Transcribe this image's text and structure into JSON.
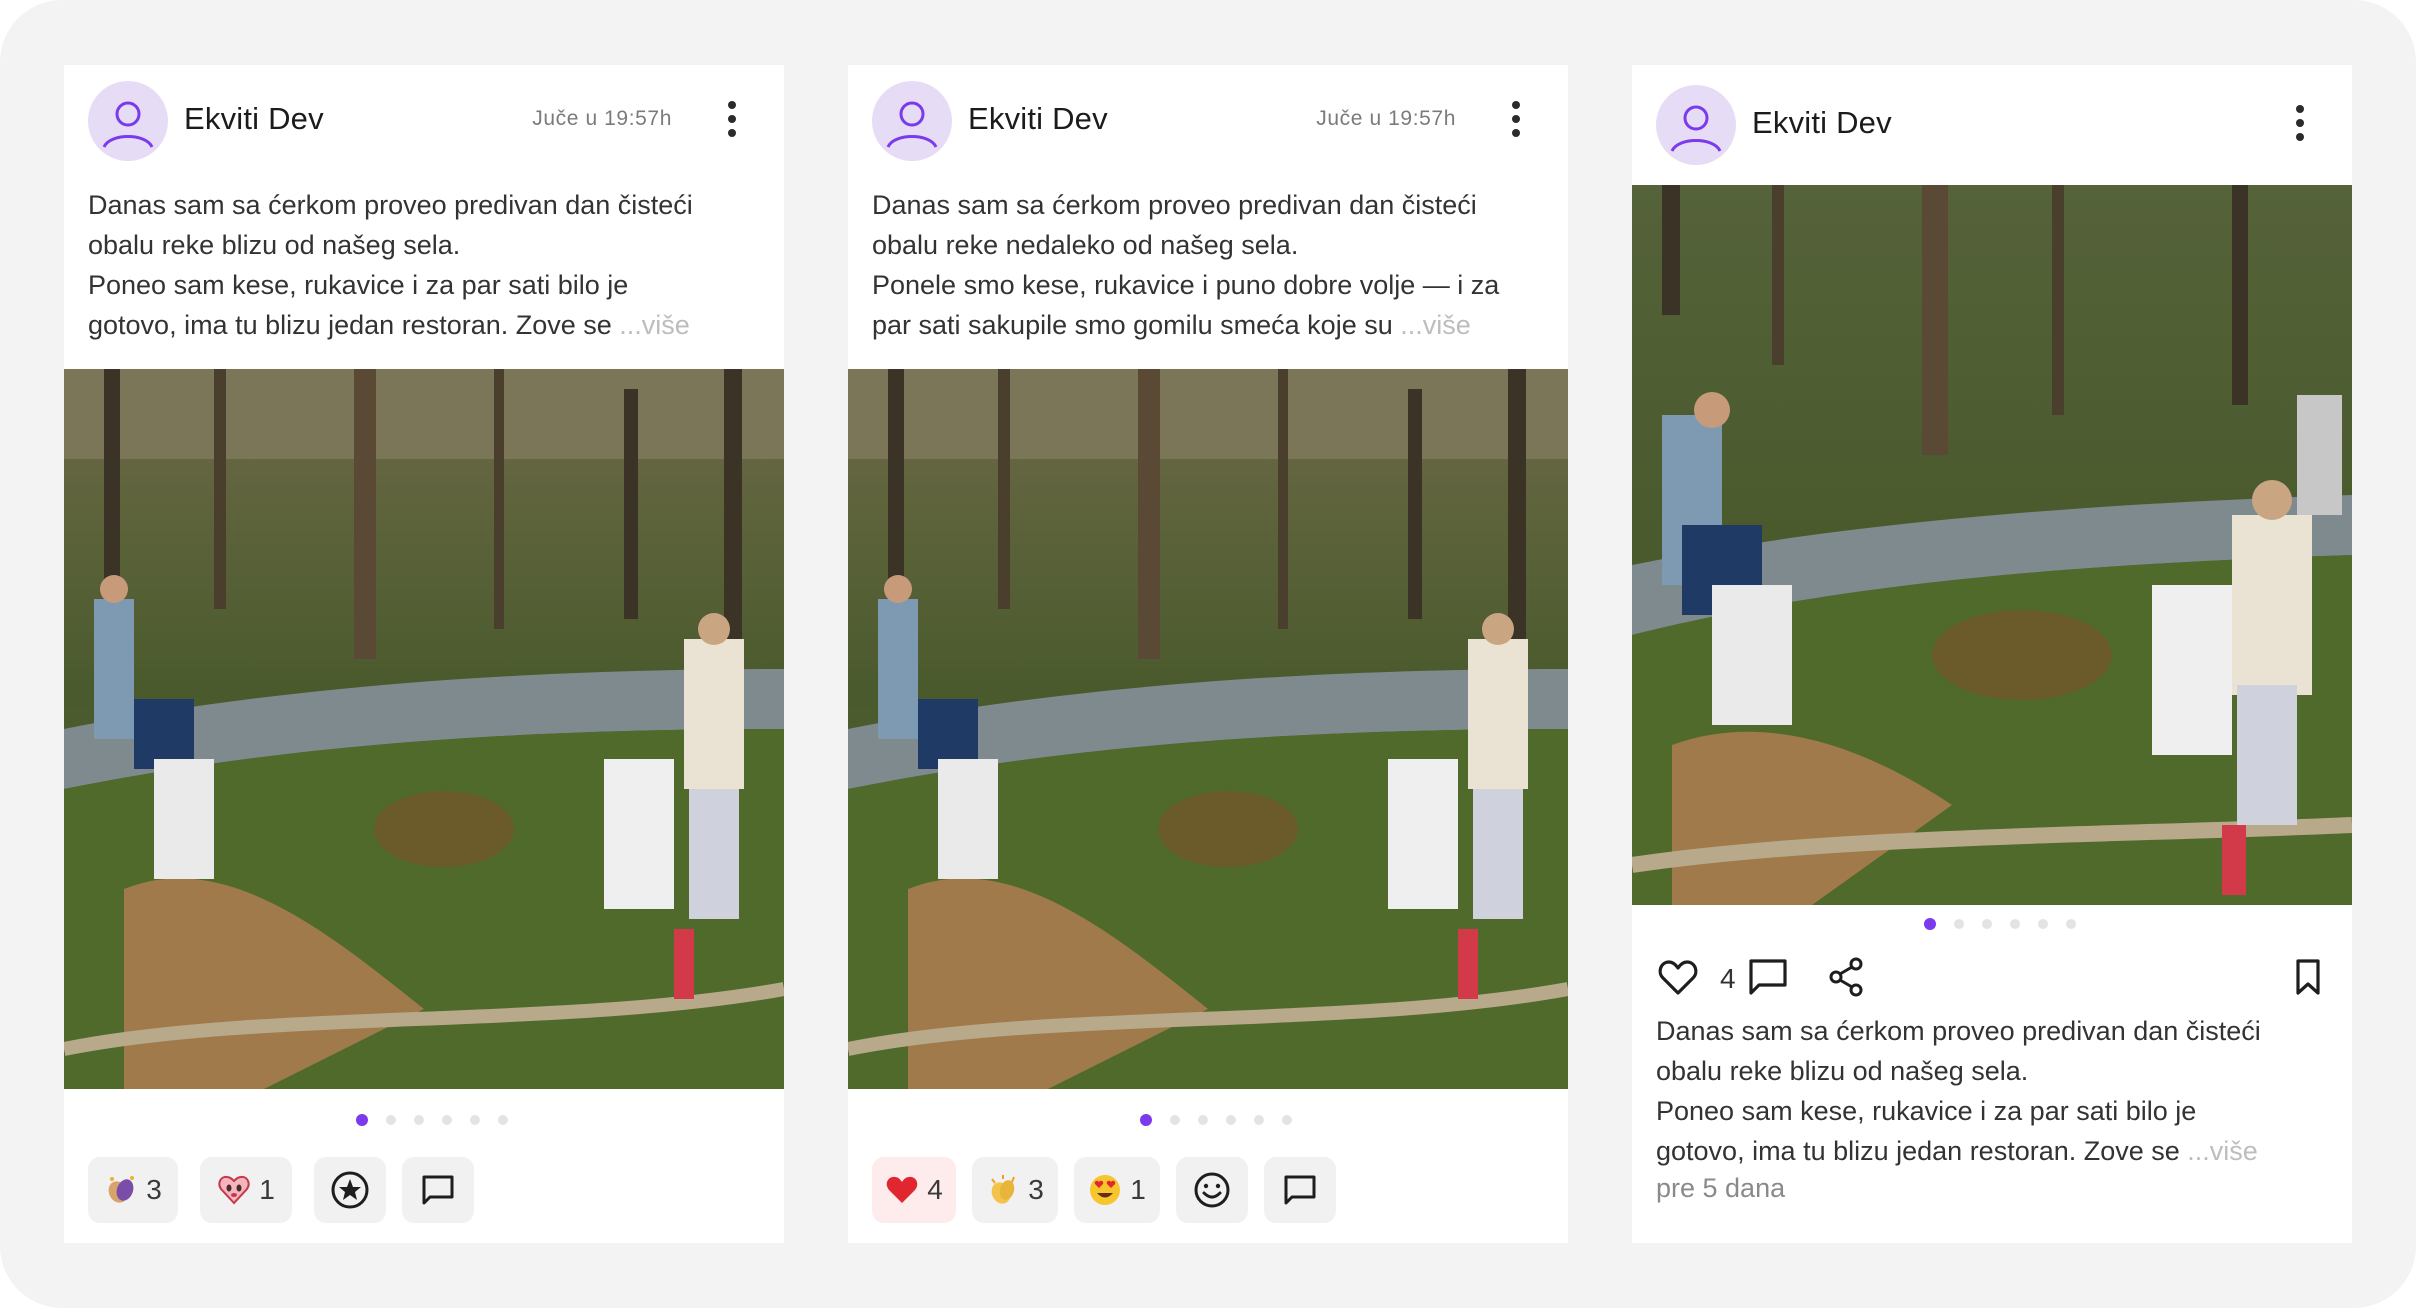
{
  "colors": {
    "accent": "#7c3aed",
    "avatar_bg": "#e6dcf6",
    "chip_bg": "#f1f1f1",
    "chip_red_bg": "#fdeceb"
  },
  "cards": [
    {
      "author": "Ekviti Dev",
      "time": "Juče u 19:57h",
      "text_lines": [
        "Danas sam sa ćerkom proveo predivan dan čisteći",
        "obalu reke blizu od našeg sela.",
        "Poneo sam kese, rukavice i za par sati bilo je",
        "gotovo, ima tu blizu jedan restoran. Zove se "
      ],
      "more_label": "...više",
      "reactions": [
        {
          "icon": "clap-hands-icon",
          "count": "3"
        },
        {
          "icon": "heart-face-icon",
          "count": "1"
        }
      ],
      "react_button_icon": "star-circle-icon",
      "comment_button_icon": "comment-icon"
    },
    {
      "author": "Ekviti Dev",
      "time": "Juče u 19:57h",
      "text_lines": [
        "Danas sam sa ćerkom proveo predivan dan čisteći",
        "obalu reke nedaleko od našeg sela.",
        "Ponele smo kese, rukavice i puno dobre volje — i za",
        "par sati sakupile smo gomilu smeća koje su "
      ],
      "more_label": "...više",
      "reactions": [
        {
          "icon": "red-heart-icon",
          "count": "4"
        },
        {
          "icon": "clap-icon",
          "count": "3"
        },
        {
          "icon": "heart-eyes-icon",
          "count": "1"
        }
      ],
      "react_button_icon": "smiley-icon",
      "comment_button_icon": "comment-icon"
    },
    {
      "author": "Ekviti Dev",
      "like_count": "4",
      "text_lines": [
        "Danas sam sa ćerkom proveo predivan dan čisteći",
        "obalu reke blizu od našeg sela.",
        "Poneo sam kese, rukavice i za par sati bilo je",
        "gotovo, ima tu blizu jedan restoran. Zove se "
      ],
      "more_label": "...više",
      "posted_ago": "pre 5 dana"
    }
  ],
  "carousel": {
    "count": 6,
    "active": 0
  }
}
